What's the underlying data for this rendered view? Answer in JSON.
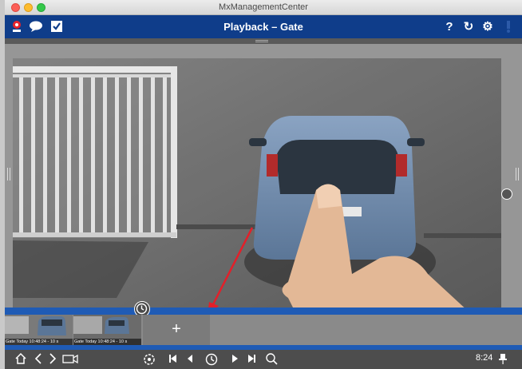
{
  "window": {
    "title": "MxManagementCenter"
  },
  "header": {
    "title": "Playback – Gate",
    "left_icons": [
      "camera-alarm-icon",
      "speech-bubble-icon",
      "checkbox-icon"
    ],
    "right_icons": [
      "help-icon",
      "refresh-icon",
      "settings-icon",
      "alarm-bell-icon"
    ],
    "help_glyph": "?",
    "refresh_glyph": "↻",
    "settings_glyph": "⚙"
  },
  "thumbnails": [
    {
      "caption": "Gate Today 10:48:24 - 10 s"
    },
    {
      "caption": "Gate Today 10:48:24 - 10 s"
    }
  ],
  "add_tile": {
    "label": "+"
  },
  "toolbar": {
    "time_readout": "8:24",
    "icons": [
      "home-icon",
      "back-icon",
      "forward-icon",
      "video-camera-icon",
      "settings-icon",
      "skip-to-start-icon",
      "step-back-icon",
      "clock-icon",
      "play-icon",
      "skip-to-end-icon",
      "search-icon",
      "pin-icon"
    ]
  },
  "colors": {
    "header_blue": "#0f3d8a",
    "timeline_blue": "#1f5bb5"
  }
}
